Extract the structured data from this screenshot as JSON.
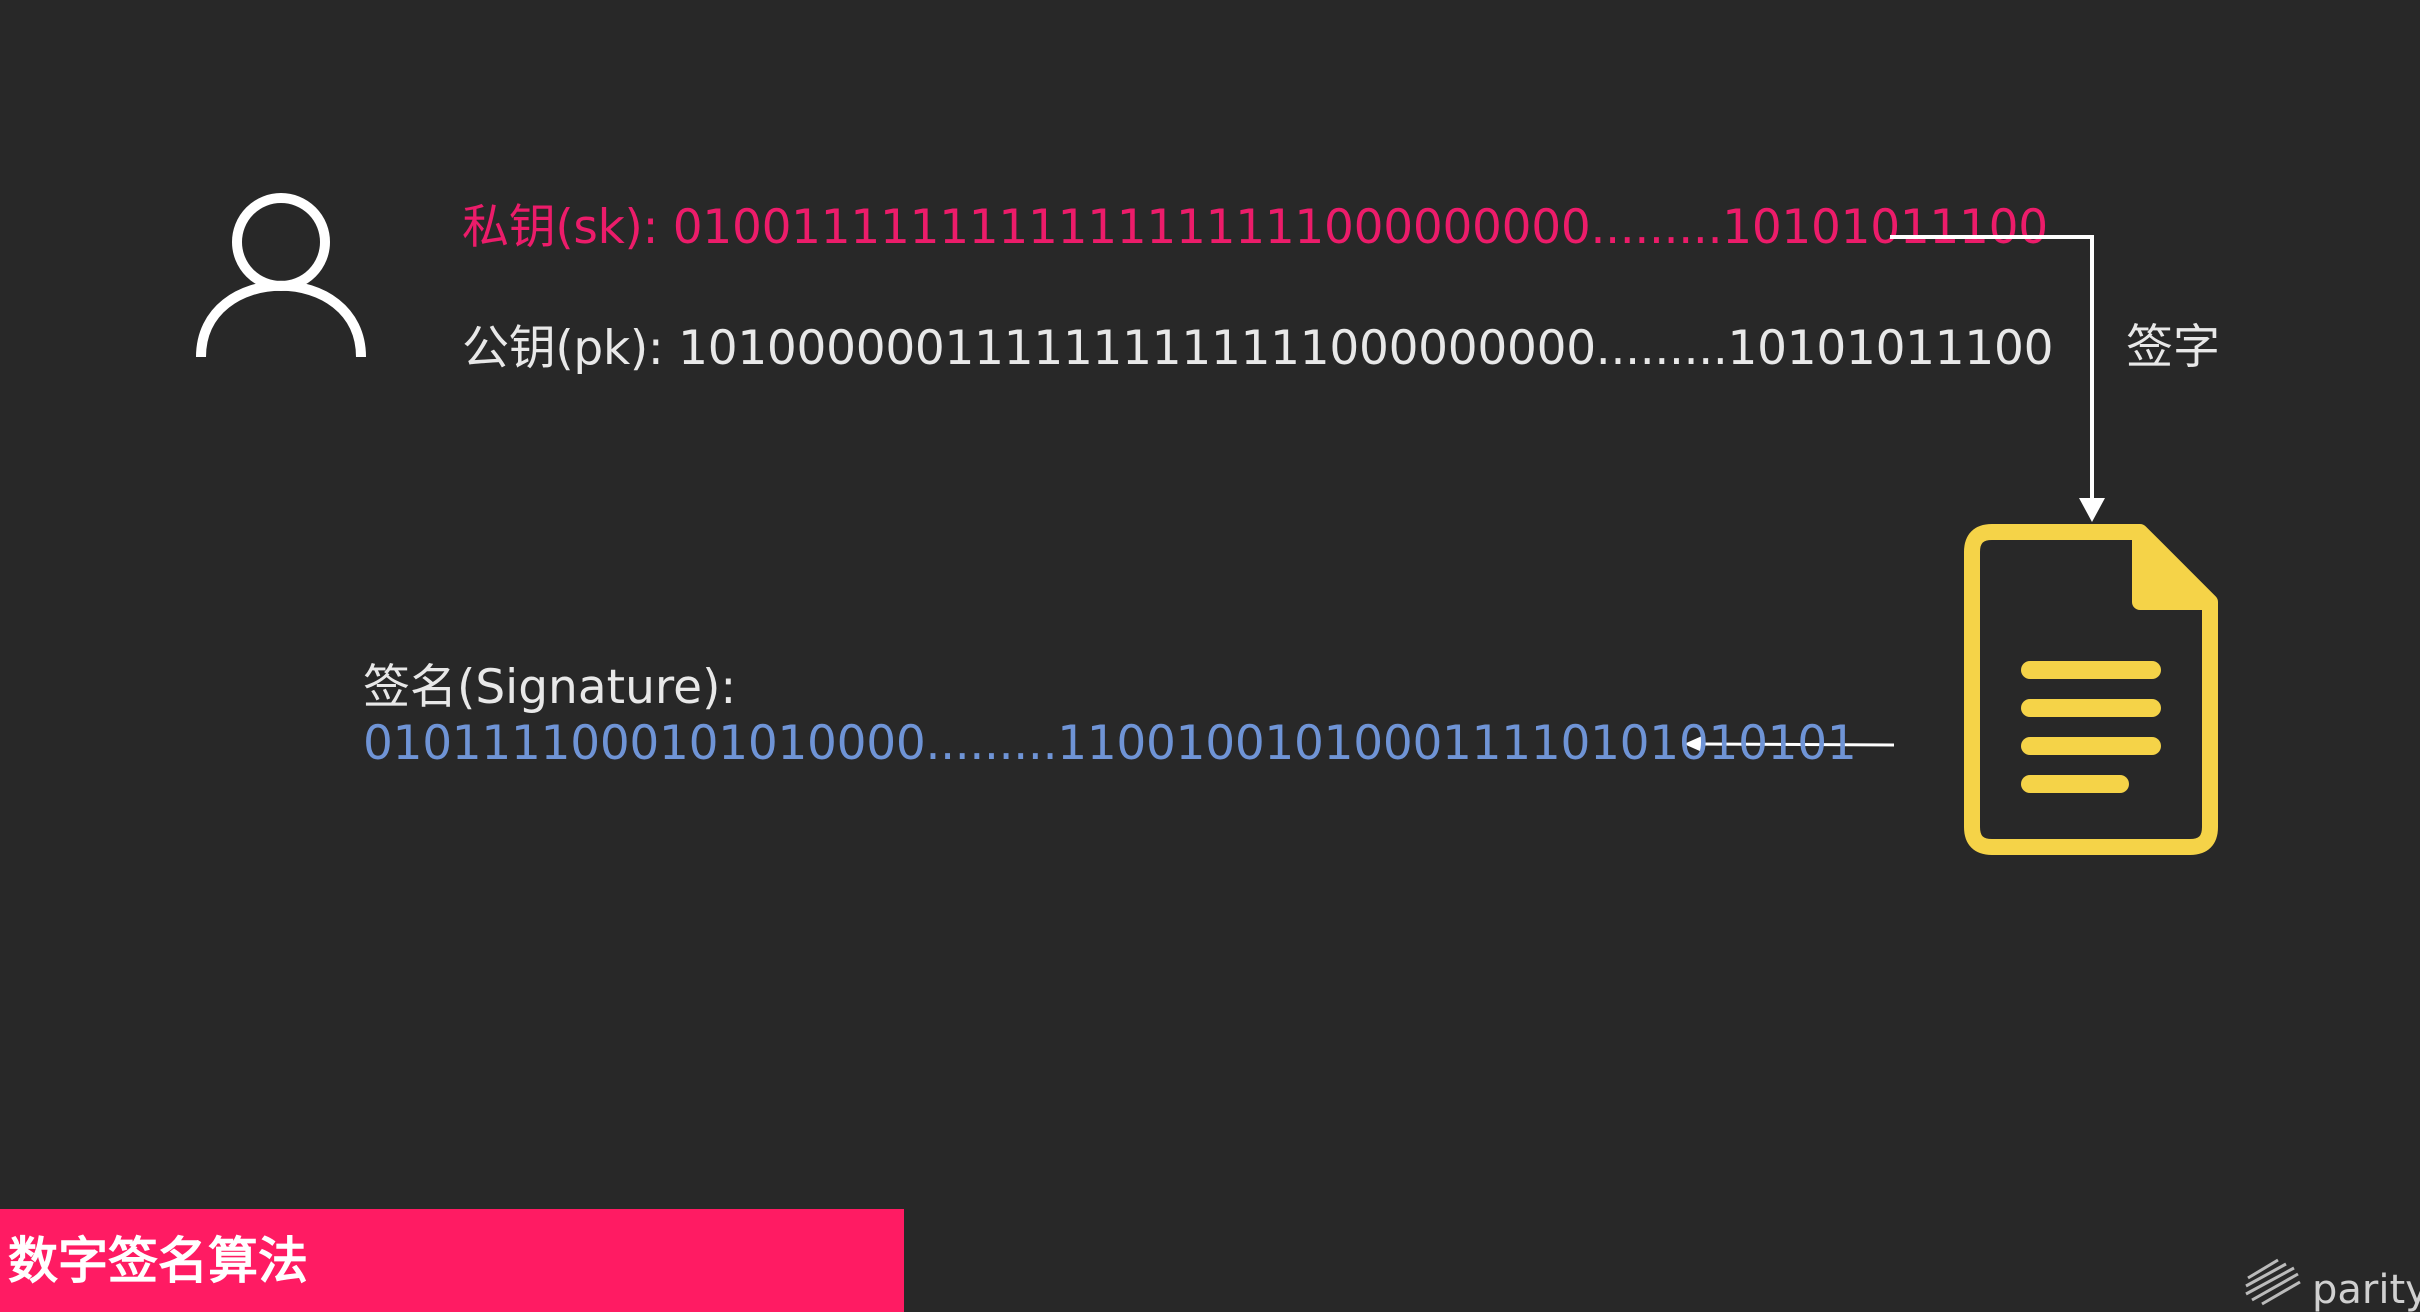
{
  "keys": {
    "private": {
      "label": "私钥(sk): ",
      "value": "0100111111111111111111000000000.........10101011100"
    },
    "public": {
      "label": "公钥(pk): ",
      "value": "1010000001111111111111000000000.........10101011100"
    }
  },
  "signature": {
    "label": "签名(Signature):",
    "value": "0101111000101010000.........110010010100011110101010101"
  },
  "flow": {
    "sign_label": "签字"
  },
  "footer": {
    "title": "数字签名算法",
    "logo_text": "parity"
  },
  "colors": {
    "background": "#282828",
    "private_key": "#ec1c6a",
    "signature": "#6f94d6",
    "document": "#f5d348",
    "banner": "#ff1b63"
  },
  "icons": {
    "user": "user-icon",
    "document": "document-icon",
    "logo": "parity-logo-icon"
  }
}
